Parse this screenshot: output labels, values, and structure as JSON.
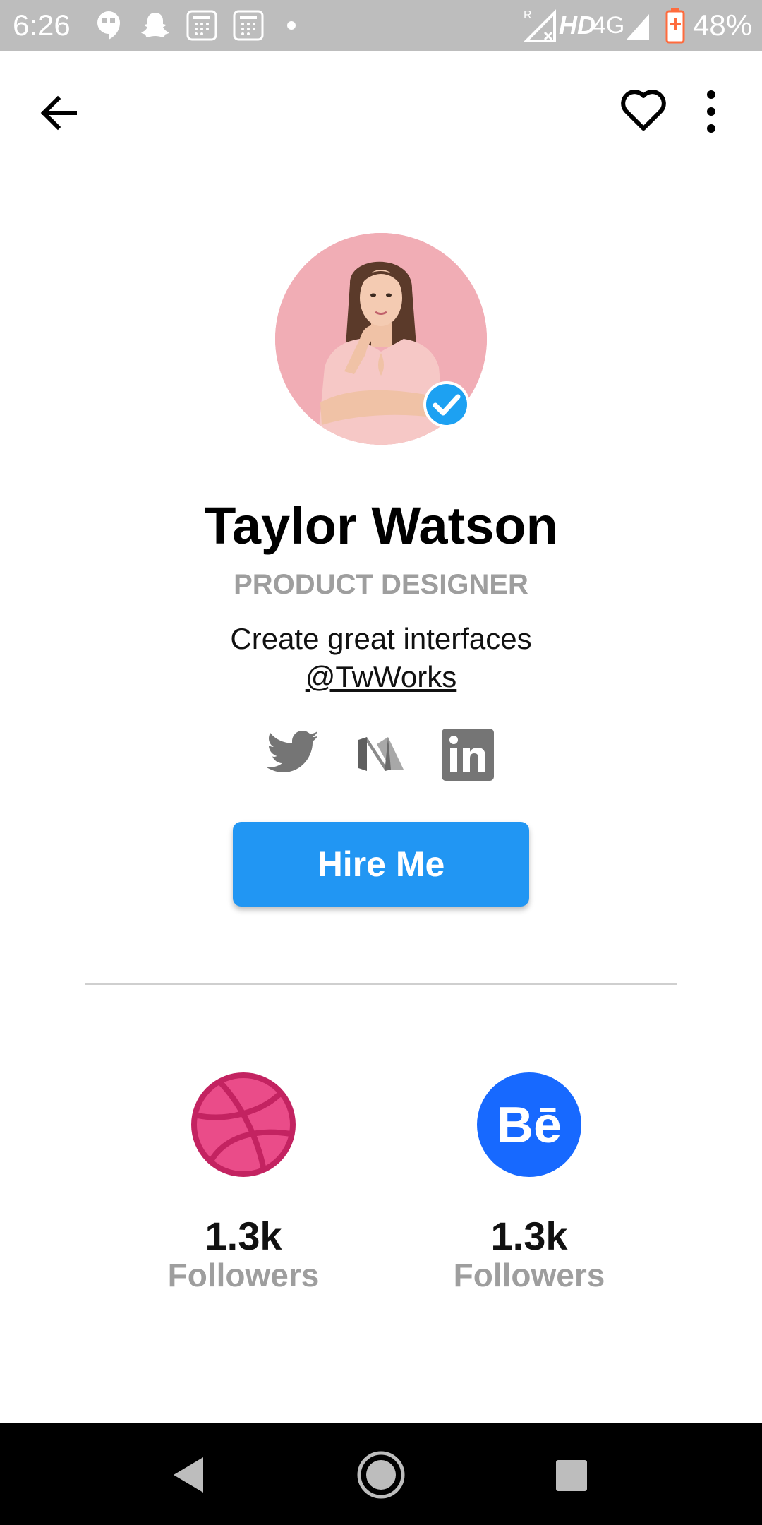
{
  "status_bar": {
    "time": "6:26",
    "network": "HD",
    "network_type": "4G",
    "battery": "48%",
    "roaming": "R"
  },
  "app_bar": {
    "back_icon": "arrow-back-icon",
    "favorite_icon": "heart-outline-icon",
    "more_icon": "more-vertical-icon"
  },
  "profile": {
    "name": "Taylor Watson",
    "role": "PRODUCT DESIGNER",
    "bio": "Create great interfaces",
    "handle": "@TwWorks",
    "verified": true
  },
  "social_links": [
    {
      "name": "twitter-icon"
    },
    {
      "name": "medium-icon"
    },
    {
      "name": "linkedin-icon"
    }
  ],
  "hire_button": {
    "label": "Hire Me"
  },
  "stats": [
    {
      "icon": "dribbble-icon",
      "value": "1.3k",
      "label": "Followers",
      "color": "#ea4c89"
    },
    {
      "icon": "behance-icon",
      "value": "1.3k",
      "label": "Followers",
      "color": "#1769ff"
    }
  ],
  "colors": {
    "accent": "#2196f3",
    "verified": "#1da1f2",
    "muted_text": "#9e9e9e",
    "status_bar": "#bdbdbd",
    "avatar_bg": "#f1adb5"
  }
}
